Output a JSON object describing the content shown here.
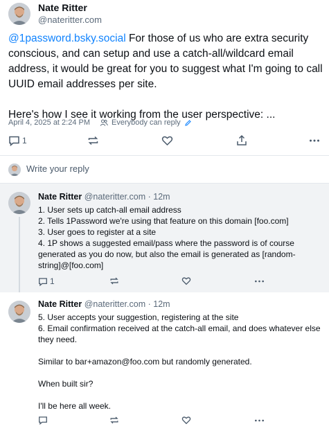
{
  "post": {
    "author_name": "Nate Ritter",
    "author_handle": "@nateritter.com",
    "mention": "@1password.bsky.social",
    "text_after_mention": " For those of us who are extra security conscious, and can setup and use a catch-all/wildcard email address, it would be great for you to suggest what I'm going to call UUID email addresses per site.",
    "text_paragraph_2": "Here's how I see it working from the user perspective: ...",
    "timestamp": "April 4, 2025 at 2:24 PM",
    "reply_setting": "Everybody can reply",
    "reply_count": "1",
    "icons": [
      "reply-icon",
      "repost-icon",
      "like-icon",
      "share-icon",
      "more-icon"
    ]
  },
  "reply_box": {
    "placeholder": "Write your reply"
  },
  "replies": [
    {
      "author_name": "Nate Ritter",
      "author_handle": "@nateritter.com",
      "time": "12m",
      "lines": [
        "1. User sets up catch-all email address",
        "2. Tells 1Password we're using that feature on this domain [foo.com]",
        "3. User goes to register at a site",
        "4. 1P shows a suggested email/pass where the password is of course generated as you do now, but also the email is generated as [random-string]@[foo.com]"
      ],
      "reply_count": "1"
    },
    {
      "author_name": "Nate Ritter",
      "author_handle": "@nateritter.com",
      "time": "12m",
      "lines": [
        "5. User accepts your suggestion, registering at the site",
        "6. Email confirmation received at the catch-all email, and does whatever else they need."
      ],
      "paragraph_2": "Similar to bar+amazon@foo.com but randomly generated.",
      "paragraph_3": "When built sir?",
      "paragraph_4": "I'll be here all week."
    }
  ],
  "colors": {
    "link": "#1083fe",
    "muted": "#5b6a7a",
    "thread_bg": "#f1f3f5"
  }
}
